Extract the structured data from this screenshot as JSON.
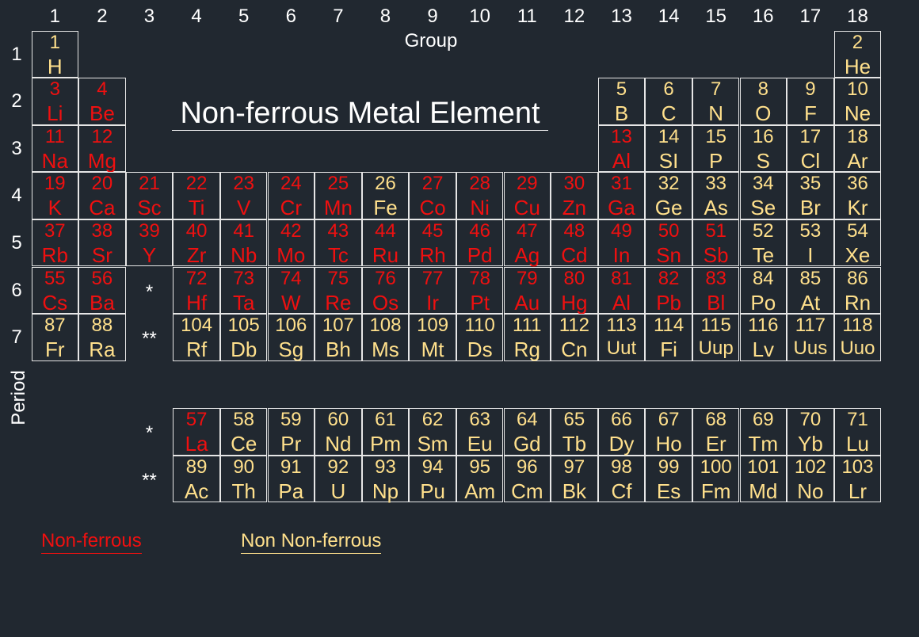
{
  "title": "Non-ferrous Metal Element",
  "group_label": "Group",
  "period_label": "Period",
  "groups": [
    "1",
    "2",
    "3",
    "4",
    "5",
    "6",
    "7",
    "8",
    "9",
    "10",
    "11",
    "12",
    "13",
    "14",
    "15",
    "16",
    "17",
    "18"
  ],
  "periods": [
    "1",
    "2",
    "3",
    "4",
    "5",
    "6",
    "7"
  ],
  "series_markers": {
    "lanthanide": "*",
    "actinide": "**"
  },
  "legend": [
    {
      "label": "Non-ferrous",
      "color": "#ef1010"
    },
    {
      "label": "Non Non-ferrous",
      "color": "#ffe08c"
    }
  ],
  "colors": {
    "background": "#212830",
    "non_ferrous": "#ef1010",
    "non_non_ferrous": "#ffe08c",
    "grid": "#e6e6e6"
  },
  "elements": [
    {
      "n": 1,
      "s": "H",
      "g": 1,
      "p": 1,
      "nf": false
    },
    {
      "n": 2,
      "s": "He",
      "g": 18,
      "p": 1,
      "nf": false
    },
    {
      "n": 3,
      "s": "Li",
      "g": 1,
      "p": 2,
      "nf": true
    },
    {
      "n": 4,
      "s": "Be",
      "g": 2,
      "p": 2,
      "nf": true
    },
    {
      "n": 5,
      "s": "B",
      "g": 13,
      "p": 2,
      "nf": false
    },
    {
      "n": 6,
      "s": "C",
      "g": 14,
      "p": 2,
      "nf": false
    },
    {
      "n": 7,
      "s": "N",
      "g": 15,
      "p": 2,
      "nf": false
    },
    {
      "n": 8,
      "s": "O",
      "g": 16,
      "p": 2,
      "nf": false
    },
    {
      "n": 9,
      "s": "F",
      "g": 17,
      "p": 2,
      "nf": false
    },
    {
      "n": 10,
      "s": "Ne",
      "g": 18,
      "p": 2,
      "nf": false
    },
    {
      "n": 11,
      "s": "Na",
      "g": 1,
      "p": 3,
      "nf": true
    },
    {
      "n": 12,
      "s": "Mg",
      "g": 2,
      "p": 3,
      "nf": true
    },
    {
      "n": 13,
      "s": "Al",
      "g": 13,
      "p": 3,
      "nf": true
    },
    {
      "n": 14,
      "s": "SI",
      "g": 14,
      "p": 3,
      "nf": false
    },
    {
      "n": 15,
      "s": "P",
      "g": 15,
      "p": 3,
      "nf": false
    },
    {
      "n": 16,
      "s": "S",
      "g": 16,
      "p": 3,
      "nf": false
    },
    {
      "n": 17,
      "s": "Cl",
      "g": 17,
      "p": 3,
      "nf": false
    },
    {
      "n": 18,
      "s": "Ar",
      "g": 18,
      "p": 3,
      "nf": false
    },
    {
      "n": 19,
      "s": "K",
      "g": 1,
      "p": 4,
      "nf": true
    },
    {
      "n": 20,
      "s": "Ca",
      "g": 2,
      "p": 4,
      "nf": true
    },
    {
      "n": 21,
      "s": "Sc",
      "g": 3,
      "p": 4,
      "nf": true
    },
    {
      "n": 22,
      "s": "Ti",
      "g": 4,
      "p": 4,
      "nf": true
    },
    {
      "n": 23,
      "s": "V",
      "g": 5,
      "p": 4,
      "nf": true
    },
    {
      "n": 24,
      "s": "Cr",
      "g": 6,
      "p": 4,
      "nf": true
    },
    {
      "n": 25,
      "s": "Mn",
      "g": 7,
      "p": 4,
      "nf": true
    },
    {
      "n": 26,
      "s": "Fe",
      "g": 8,
      "p": 4,
      "nf": false
    },
    {
      "n": 27,
      "s": "Co",
      "g": 9,
      "p": 4,
      "nf": true
    },
    {
      "n": 28,
      "s": "Ni",
      "g": 10,
      "p": 4,
      "nf": true
    },
    {
      "n": 29,
      "s": "Cu",
      "g": 11,
      "p": 4,
      "nf": true
    },
    {
      "n": 30,
      "s": "Zn",
      "g": 12,
      "p": 4,
      "nf": true
    },
    {
      "n": 31,
      "s": "Ga",
      "g": 13,
      "p": 4,
      "nf": true
    },
    {
      "n": 32,
      "s": "Ge",
      "g": 14,
      "p": 4,
      "nf": false
    },
    {
      "n": 33,
      "s": "As",
      "g": 15,
      "p": 4,
      "nf": false
    },
    {
      "n": 34,
      "s": "Se",
      "g": 16,
      "p": 4,
      "nf": false
    },
    {
      "n": 35,
      "s": "Br",
      "g": 17,
      "p": 4,
      "nf": false
    },
    {
      "n": 36,
      "s": "Kr",
      "g": 18,
      "p": 4,
      "nf": false
    },
    {
      "n": 37,
      "s": "Rb",
      "g": 1,
      "p": 5,
      "nf": true
    },
    {
      "n": 38,
      "s": "Sr",
      "g": 2,
      "p": 5,
      "nf": true
    },
    {
      "n": 39,
      "s": "Y",
      "g": 3,
      "p": 5,
      "nf": true
    },
    {
      "n": 40,
      "s": "Zr",
      "g": 4,
      "p": 5,
      "nf": true
    },
    {
      "n": 41,
      "s": "Nb",
      "g": 5,
      "p": 5,
      "nf": true
    },
    {
      "n": 42,
      "s": "Mo",
      "g": 6,
      "p": 5,
      "nf": true
    },
    {
      "n": 43,
      "s": "Tc",
      "g": 7,
      "p": 5,
      "nf": true
    },
    {
      "n": 44,
      "s": "Ru",
      "g": 8,
      "p": 5,
      "nf": true
    },
    {
      "n": 45,
      "s": "Rh",
      "g": 9,
      "p": 5,
      "nf": true
    },
    {
      "n": 46,
      "s": "Pd",
      "g": 10,
      "p": 5,
      "nf": true
    },
    {
      "n": 47,
      "s": "Ag",
      "g": 11,
      "p": 5,
      "nf": true
    },
    {
      "n": 48,
      "s": "Cd",
      "g": 12,
      "p": 5,
      "nf": true
    },
    {
      "n": 49,
      "s": "In",
      "g": 13,
      "p": 5,
      "nf": true
    },
    {
      "n": 50,
      "s": "Sn",
      "g": 14,
      "p": 5,
      "nf": true
    },
    {
      "n": 51,
      "s": "Sb",
      "g": 15,
      "p": 5,
      "nf": true
    },
    {
      "n": 52,
      "s": "Te",
      "g": 16,
      "p": 5,
      "nf": false
    },
    {
      "n": 53,
      "s": "I",
      "g": 17,
      "p": 5,
      "nf": false
    },
    {
      "n": 54,
      "s": "Xe",
      "g": 18,
      "p": 5,
      "nf": false
    },
    {
      "n": 55,
      "s": "Cs",
      "g": 1,
      "p": 6,
      "nf": true
    },
    {
      "n": 56,
      "s": "Ba",
      "g": 2,
      "p": 6,
      "nf": true
    },
    {
      "n": 72,
      "s": "Hf",
      "g": 4,
      "p": 6,
      "nf": true
    },
    {
      "n": 73,
      "s": "Ta",
      "g": 5,
      "p": 6,
      "nf": true
    },
    {
      "n": 74,
      "s": "W",
      "g": 6,
      "p": 6,
      "nf": true
    },
    {
      "n": 75,
      "s": "Re",
      "g": 7,
      "p": 6,
      "nf": true
    },
    {
      "n": 76,
      "s": "Os",
      "g": 8,
      "p": 6,
      "nf": true
    },
    {
      "n": 77,
      "s": "Ir",
      "g": 9,
      "p": 6,
      "nf": true
    },
    {
      "n": 78,
      "s": "Pt",
      "g": 10,
      "p": 6,
      "nf": true
    },
    {
      "n": 79,
      "s": "Au",
      "g": 11,
      "p": 6,
      "nf": true
    },
    {
      "n": 80,
      "s": "Hg",
      "g": 12,
      "p": 6,
      "nf": true
    },
    {
      "n": 81,
      "s": "Al",
      "g": 13,
      "p": 6,
      "nf": true
    },
    {
      "n": 82,
      "s": "Pb",
      "g": 14,
      "p": 6,
      "nf": true
    },
    {
      "n": 83,
      "s": "Bl",
      "g": 15,
      "p": 6,
      "nf": true
    },
    {
      "n": 84,
      "s": "Po",
      "g": 16,
      "p": 6,
      "nf": false
    },
    {
      "n": 85,
      "s": "At",
      "g": 17,
      "p": 6,
      "nf": false
    },
    {
      "n": 86,
      "s": "Rn",
      "g": 18,
      "p": 6,
      "nf": false
    },
    {
      "n": 87,
      "s": "Fr",
      "g": 1,
      "p": 7,
      "nf": false
    },
    {
      "n": 88,
      "s": "Ra",
      "g": 2,
      "p": 7,
      "nf": false
    },
    {
      "n": 104,
      "s": "Rf",
      "g": 4,
      "p": 7,
      "nf": false
    },
    {
      "n": 105,
      "s": "Db",
      "g": 5,
      "p": 7,
      "nf": false
    },
    {
      "n": 106,
      "s": "Sg",
      "g": 6,
      "p": 7,
      "nf": false
    },
    {
      "n": 107,
      "s": "Bh",
      "g": 7,
      "p": 7,
      "nf": false
    },
    {
      "n": 108,
      "s": "Ms",
      "g": 8,
      "p": 7,
      "nf": false
    },
    {
      "n": 109,
      "s": "Mt",
      "g": 9,
      "p": 7,
      "nf": false
    },
    {
      "n": 110,
      "s": "Ds",
      "g": 10,
      "p": 7,
      "nf": false
    },
    {
      "n": 111,
      "s": "Rg",
      "g": 11,
      "p": 7,
      "nf": false
    },
    {
      "n": 112,
      "s": "Cn",
      "g": 12,
      "p": 7,
      "nf": false
    },
    {
      "n": 113,
      "s": "Uut",
      "g": 13,
      "p": 7,
      "nf": false
    },
    {
      "n": 114,
      "s": "Fi",
      "g": 14,
      "p": 7,
      "nf": false
    },
    {
      "n": 115,
      "s": "Uup",
      "g": 15,
      "p": 7,
      "nf": false
    },
    {
      "n": 116,
      "s": "Lv",
      "g": 16,
      "p": 7,
      "nf": false
    },
    {
      "n": 117,
      "s": "Uus",
      "g": 17,
      "p": 7,
      "nf": false
    },
    {
      "n": 118,
      "s": "Uuo",
      "g": 18,
      "p": 7,
      "nf": false
    },
    {
      "n": 57,
      "s": "La",
      "g": 4,
      "p": "lanthanide",
      "nf": true
    },
    {
      "n": 58,
      "s": "Ce",
      "g": 5,
      "p": "lanthanide",
      "nf": false
    },
    {
      "n": 59,
      "s": "Pr",
      "g": 6,
      "p": "lanthanide",
      "nf": false
    },
    {
      "n": 60,
      "s": "Nd",
      "g": 7,
      "p": "lanthanide",
      "nf": false
    },
    {
      "n": 61,
      "s": "Pm",
      "g": 8,
      "p": "lanthanide",
      "nf": false
    },
    {
      "n": 62,
      "s": "Sm",
      "g": 9,
      "p": "lanthanide",
      "nf": false
    },
    {
      "n": 63,
      "s": "Eu",
      "g": 10,
      "p": "lanthanide",
      "nf": false
    },
    {
      "n": 64,
      "s": "Gd",
      "g": 11,
      "p": "lanthanide",
      "nf": false
    },
    {
      "n": 65,
      "s": "Tb",
      "g": 12,
      "p": "lanthanide",
      "nf": false
    },
    {
      "n": 66,
      "s": "Dy",
      "g": 13,
      "p": "lanthanide",
      "nf": false
    },
    {
      "n": 67,
      "s": "Ho",
      "g": 14,
      "p": "lanthanide",
      "nf": false
    },
    {
      "n": 68,
      "s": "Er",
      "g": 15,
      "p": "lanthanide",
      "nf": false
    },
    {
      "n": 69,
      "s": "Tm",
      "g": 16,
      "p": "lanthanide",
      "nf": false
    },
    {
      "n": 70,
      "s": "Yb",
      "g": 17,
      "p": "lanthanide",
      "nf": false
    },
    {
      "n": 71,
      "s": "Lu",
      "g": 18,
      "p": "lanthanide",
      "nf": false
    },
    {
      "n": 89,
      "s": "Ac",
      "g": 4,
      "p": "actinide",
      "nf": false
    },
    {
      "n": 90,
      "s": "Th",
      "g": 5,
      "p": "actinide",
      "nf": false
    },
    {
      "n": 91,
      "s": "Pa",
      "g": 6,
      "p": "actinide",
      "nf": false
    },
    {
      "n": 92,
      "s": "U",
      "g": 7,
      "p": "actinide",
      "nf": false
    },
    {
      "n": 93,
      "s": "Np",
      "g": 8,
      "p": "actinide",
      "nf": false
    },
    {
      "n": 94,
      "s": "Pu",
      "g": 9,
      "p": "actinide",
      "nf": false
    },
    {
      "n": 95,
      "s": "Am",
      "g": 10,
      "p": "actinide",
      "nf": false
    },
    {
      "n": 96,
      "s": "Cm",
      "g": 11,
      "p": "actinide",
      "nf": false
    },
    {
      "n": 97,
      "s": "Bk",
      "g": 12,
      "p": "actinide",
      "nf": false
    },
    {
      "n": 98,
      "s": "Cf",
      "g": 13,
      "p": "actinide",
      "nf": false
    },
    {
      "n": 99,
      "s": "Es",
      "g": 14,
      "p": "actinide",
      "nf": false
    },
    {
      "n": 100,
      "s": "Fm",
      "g": 15,
      "p": "actinide",
      "nf": false
    },
    {
      "n": 101,
      "s": "Md",
      "g": 16,
      "p": "actinide",
      "nf": false
    },
    {
      "n": 102,
      "s": "No",
      "g": 17,
      "p": "actinide",
      "nf": false
    },
    {
      "n": 103,
      "s": "Lr",
      "g": 18,
      "p": "actinide",
      "nf": false
    }
  ]
}
